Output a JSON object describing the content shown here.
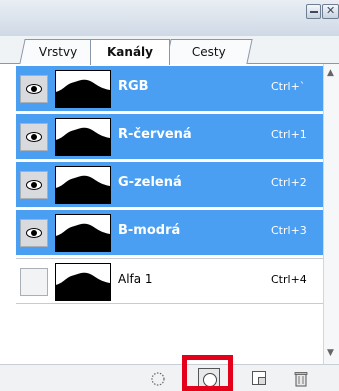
{
  "tabs": [
    {
      "label": "Vrstvy"
    },
    {
      "label": "Kanály"
    },
    {
      "label": "Cesty"
    }
  ],
  "overflow_indicator": "»",
  "channels": [
    {
      "name": "RGB",
      "shortcut": "Ctrl+`",
      "selected": true,
      "visible": true
    },
    {
      "name": "R-červená",
      "shortcut": "Ctrl+1",
      "selected": true,
      "visible": true
    },
    {
      "name": "G-zelená",
      "shortcut": "Ctrl+2",
      "selected": true,
      "visible": true
    },
    {
      "name": "B-modrá",
      "shortcut": "Ctrl+3",
      "selected": true,
      "visible": true
    },
    {
      "name": "Alfa 1",
      "shortcut": "Ctrl+4",
      "selected": false,
      "visible": false
    }
  ],
  "colors": {
    "selection": "#4a9ff3",
    "highlight_box": "#e4001b"
  },
  "bottom_icons": [
    "load-selection-icon",
    "save-selection-mask-icon",
    "new-channel-icon",
    "delete-channel-icon"
  ]
}
